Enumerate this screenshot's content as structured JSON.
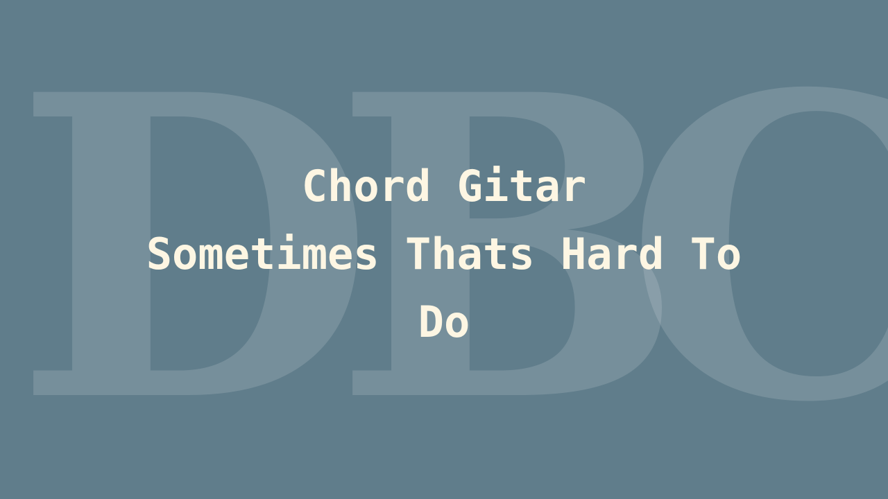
{
  "watermark": {
    "letters": [
      "D",
      "B",
      "C"
    ]
  },
  "title": {
    "lines": [
      "Chord Gitar",
      "Sometimes Thats Hard To",
      "Do"
    ]
  },
  "colors": {
    "background": "#607d8b",
    "title_text": "#fdf6e3",
    "watermark": "rgba(255,255,255,0.14)"
  }
}
